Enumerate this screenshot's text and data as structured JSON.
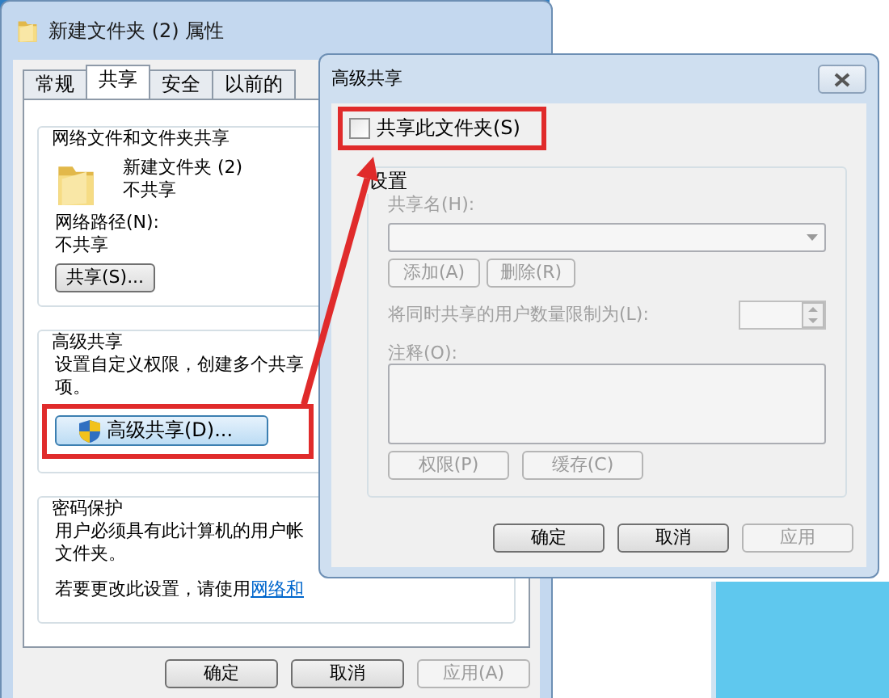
{
  "properties_dialog": {
    "title": "新建文件夹 (2) 属性",
    "tabs": [
      {
        "label": "常规",
        "selected": false
      },
      {
        "label": "共享",
        "selected": true
      },
      {
        "label": "安全",
        "selected": false
      },
      {
        "label": "以前的",
        "selected": false
      }
    ],
    "network_sharing": {
      "heading": "网络文件和文件夹共享",
      "folder_name": "新建文件夹 (2)",
      "status": "不共享",
      "path_label": "网络路径(N):",
      "path_value": "不共享",
      "share_button": "共享(S)..."
    },
    "advanced_sharing": {
      "heading": "高级共享",
      "description_lines": [
        "设置自定义权限，创建多个共享",
        "项。"
      ],
      "button": "高级共享(D)..."
    },
    "password_protection": {
      "heading": "密码保护",
      "description_lines": [
        "用户必须具有此计算机的用户帐",
        "文件夹。"
      ],
      "change_text": "若要更改此设置，请使用",
      "link": "网络和"
    },
    "buttons": [
      {
        "label": "确定",
        "disabled": false
      },
      {
        "label": "取消",
        "disabled": false
      },
      {
        "label": "应用(A)",
        "disabled": true
      }
    ]
  },
  "advanced_dialog": {
    "title": "高级共享",
    "share_checkbox": {
      "label": "共享此文件夹(S)",
      "checked": false
    },
    "settings": {
      "heading": "设置",
      "disabled": true,
      "share_name_label": "共享名(H):",
      "add_button": "添加(A)",
      "remove_button": "删除(R)",
      "limit_label": "将同时共享的用户数量限制为(L):",
      "comments_label": "注释(O):",
      "permissions_button": "权限(P)",
      "caching_button": "缓存(C)"
    },
    "buttons": [
      {
        "label": "确定",
        "disabled": false
      },
      {
        "label": "取消",
        "disabled": false
      },
      {
        "label": "应用",
        "disabled": true
      }
    ]
  }
}
